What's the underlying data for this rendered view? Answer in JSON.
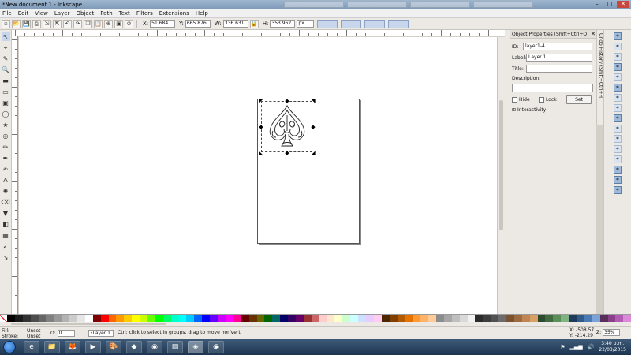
{
  "window": {
    "title": "*New document 1 - Inkscape",
    "controls": {
      "minimize": "–",
      "maximize": "□",
      "close": "✕"
    }
  },
  "menu": [
    "File",
    "Edit",
    "View",
    "Layer",
    "Object",
    "Path",
    "Text",
    "Filters",
    "Extensions",
    "Help"
  ],
  "command_bar": {
    "icons": [
      "new-icon",
      "open-icon",
      "save-icon",
      "print-icon",
      "import-icon",
      "export-icon",
      "undo-icon",
      "redo-icon",
      "copy-icon",
      "paste-icon",
      "zoom-icon",
      "group-icon",
      "lock-icon"
    ],
    "x_label": "X:",
    "x_value": "51.684",
    "y_label": "Y:",
    "y_value": "665.876",
    "w_label": "W:",
    "w_value": "336.631",
    "h_label": "H:",
    "h_value": "353.962",
    "unit": "px"
  },
  "toolbox": [
    "select",
    "node",
    "tweak",
    "zoom",
    "measure",
    "rect",
    "3dbox",
    "ellipse",
    "star",
    "spiral",
    "pencil",
    "pen",
    "calligraphy",
    "text",
    "spray",
    "eraser",
    "bucket",
    "gradient",
    "mesh",
    "dropper",
    "connector"
  ],
  "toolbox_glyphs": [
    "↖",
    "⌖",
    "✎",
    "🔍",
    "▬",
    "▭",
    "▣",
    "◯",
    "★",
    "◎",
    "✏",
    "✒",
    "✍",
    "A",
    "✺",
    "⌫",
    "▼",
    "◧",
    "▦",
    "✓",
    "↘"
  ],
  "object_properties": {
    "title": "Object Properties (Shift+Ctrl+O)",
    "id_label": "ID:",
    "id_value": "layer1-4",
    "label_label": "Label:",
    "label_value": "Layer 1",
    "title_label": "Title:",
    "title_value": "",
    "description_label": "Description:",
    "description_value": "",
    "hide_label": "Hide",
    "lock_label": "Lock",
    "set_button": "Set",
    "interactivity": "Interactivity"
  },
  "undo_history_tab": "Undo History (Shift+Ctrl+H)",
  "snap_controls": [
    "snap-toggle",
    "snap-bbox",
    "snap-bbox-edge",
    "snap-bbox-corner",
    "snap-bbox-mid",
    "snap-nodes",
    "snap-path",
    "snap-intersect",
    "snap-cusp",
    "snap-smooth",
    "snap-midpoint",
    "snap-center",
    "snap-rotation",
    "snap-page",
    "snap-grid",
    "snap-guide"
  ],
  "snap_active": [
    true,
    false,
    false,
    true,
    false,
    true,
    false,
    false,
    true,
    false,
    false,
    false,
    false,
    true,
    true,
    true
  ],
  "palette": [
    "#000000",
    "#1a1a1a",
    "#333333",
    "#4d4d4d",
    "#666666",
    "#808080",
    "#999999",
    "#b3b3b3",
    "#cccccc",
    "#e6e6e6",
    "#ffffff",
    "#800000",
    "#ff0000",
    "#ff6600",
    "#ff9900",
    "#ffcc00",
    "#ffff00",
    "#ccff00",
    "#66ff00",
    "#00ff00",
    "#00ff66",
    "#00ffcc",
    "#00ffff",
    "#00ccff",
    "#0066ff",
    "#0000ff",
    "#6600ff",
    "#cc00ff",
    "#ff00ff",
    "#ff0099",
    "#660000",
    "#663300",
    "#666600",
    "#006600",
    "#006666",
    "#000066",
    "#330066",
    "#660066",
    "#993333",
    "#cc6666",
    "#ffcccc",
    "#ffe6cc",
    "#ffffcc",
    "#ccffcc",
    "#ccffff",
    "#cce0ff",
    "#e6ccff",
    "#ffccf2",
    "#4d2600",
    "#804000",
    "#b35900",
    "#e67300",
    "#ff9933",
    "#ffb366",
    "#ffcc99",
    "#8c8c8c",
    "#a6a6a6",
    "#bfbfbf",
    "#d9d9d9",
    "#f2f2f2",
    "#2b2b2b",
    "#3d3d3d",
    "#525252",
    "#6b6b6b",
    "#7a5230",
    "#9c6b3f",
    "#c08552",
    "#d9a066",
    "#2e4a2e",
    "#3f6b3f",
    "#5a8f5a",
    "#7fb37f",
    "#1f3a5a",
    "#2f5a8a",
    "#4a7ab3",
    "#7aa3d9",
    "#5a2e5a",
    "#8a3f8a",
    "#b35ab3",
    "#d98ad9"
  ],
  "status": {
    "fill_label": "Fill:",
    "stroke_label": "Stroke:",
    "fill_value": "Unset",
    "stroke_value": "Unset",
    "opacity_label": "O:",
    "opacity_value": "0",
    "layer": "•Layer 1",
    "message": "Ctrl: click to select in groups; drag to move hor/vert",
    "x_label": "X:",
    "x_value": "-508.57",
    "y_label": "Y:",
    "y_value": "-214.29",
    "zoom_label": "Z:",
    "zoom_value": "35%"
  },
  "taskbar": {
    "apps": [
      "ie",
      "explorer",
      "firefox",
      "media",
      "paint",
      "kodi",
      "chrome",
      "app",
      "inkscape",
      "chrome-2"
    ],
    "app_glyphs": [
      "e",
      "📁",
      "🦊",
      "▶",
      "🎨",
      "◆",
      "◉",
      "▤",
      "◈",
      "◉"
    ],
    "time": "3:40 p.m.",
    "date": "22/03/2015"
  }
}
